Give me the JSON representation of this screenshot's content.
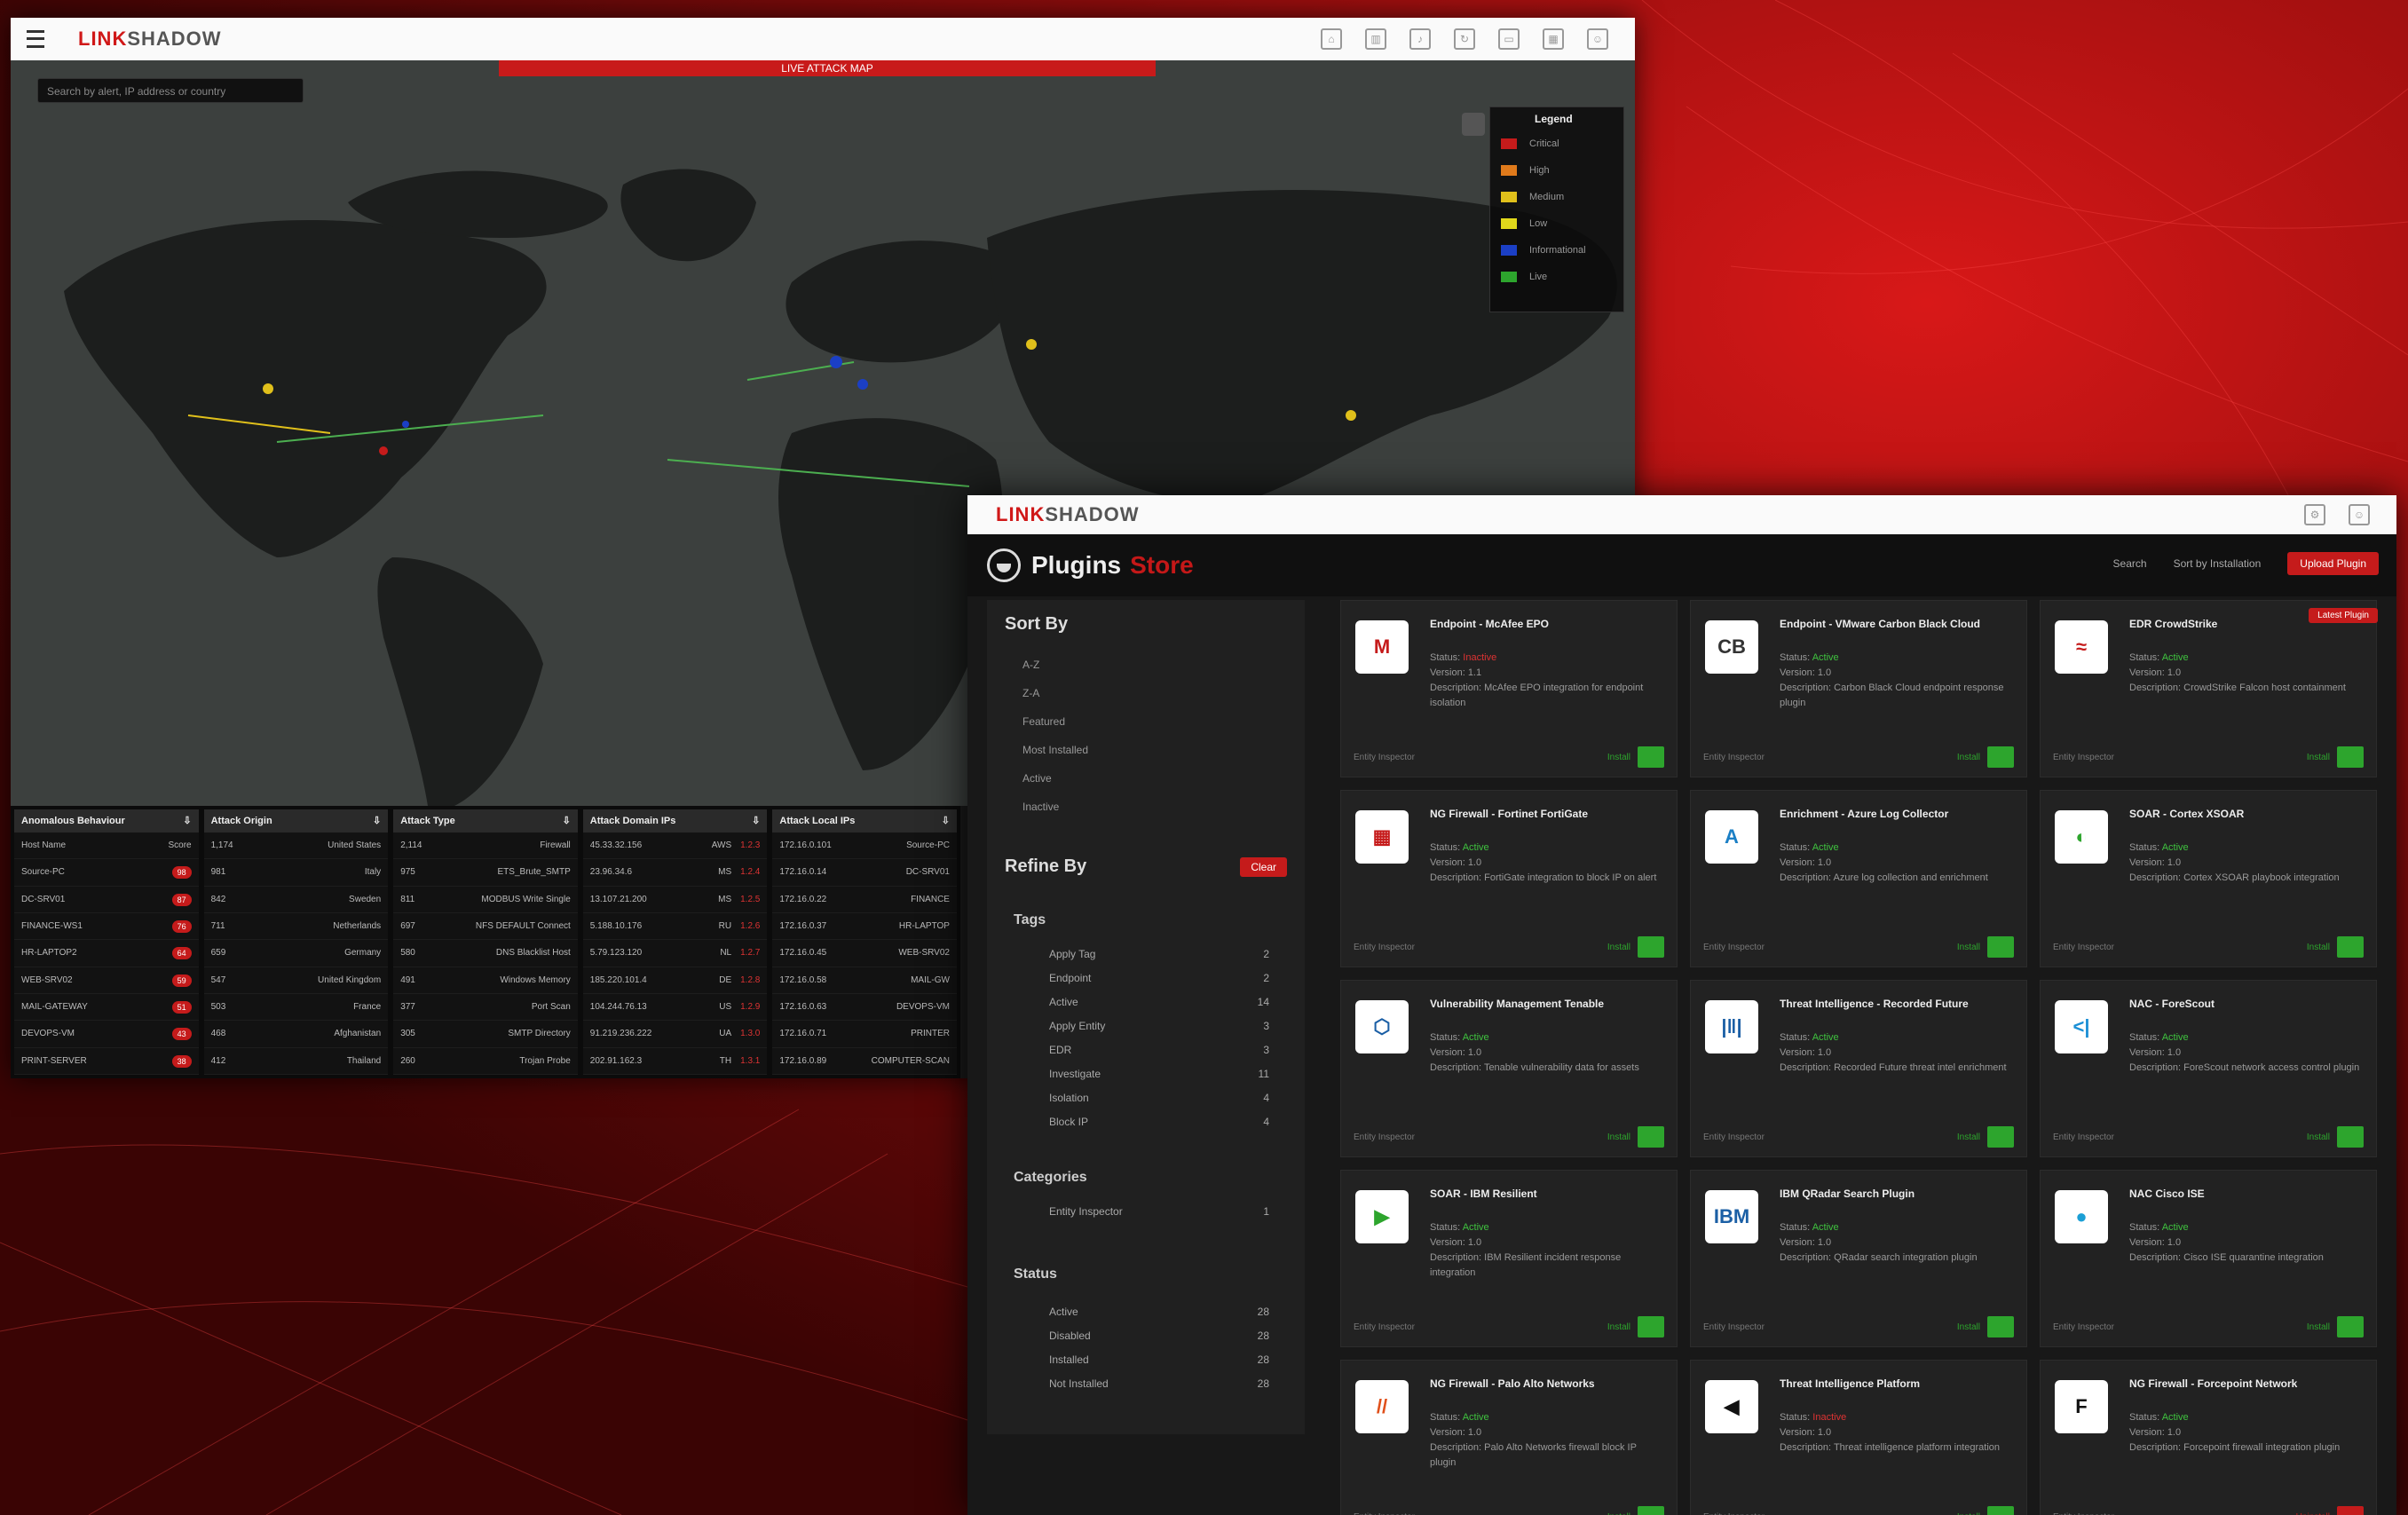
{
  "map_window": {
    "logo_a": "LINK",
    "logo_b": "SHADOW",
    "alert_strip": "LIVE ATTACK MAP",
    "search_placeholder": "Search by alert, IP address or country",
    "legend": {
      "title": "Legend",
      "items": [
        {
          "label": "Critical",
          "color": "#c51b1b"
        },
        {
          "label": "High",
          "color": "#e07a1b"
        },
        {
          "label": "Medium",
          "color": "#e0c01b"
        },
        {
          "label": "Low",
          "color": "#e0d81b"
        },
        {
          "label": "Informational",
          "color": "#1b3fc5"
        },
        {
          "label": "Live",
          "color": "#2da52d"
        }
      ]
    },
    "tables": [
      {
        "title": "Anomalous Behaviour",
        "rows": [
          [
            "Host Name",
            "Score"
          ],
          [
            "Source-PC",
            "98"
          ],
          [
            "DC-SRV01",
            "87"
          ],
          [
            "FINANCE-WS1",
            "76"
          ],
          [
            "HR-LAPTOP2",
            "64"
          ],
          [
            "WEB-SRV02",
            "59"
          ],
          [
            "MAIL-GATEWAY",
            "51"
          ],
          [
            "DEVOPS-VM",
            "43"
          ],
          [
            "PRINT-SERVER",
            "38"
          ]
        ]
      },
      {
        "title": "Attack Origin",
        "rows": [
          [
            "1,174",
            "United States"
          ],
          [
            "981",
            "Italy"
          ],
          [
            "842",
            "Sweden"
          ],
          [
            "711",
            "Netherlands"
          ],
          [
            "659",
            "Germany"
          ],
          [
            "547",
            "United Kingdom"
          ],
          [
            "503",
            "France"
          ],
          [
            "468",
            "Afghanistan"
          ],
          [
            "412",
            "Thailand"
          ]
        ]
      },
      {
        "title": "Attack Type",
        "rows": [
          [
            "2,114",
            "Firewall"
          ],
          [
            "975",
            "ETS_Brute_SMTP"
          ],
          [
            "811",
            "MODBUS Write Single"
          ],
          [
            "697",
            "NFS DEFAULT Connect"
          ],
          [
            "580",
            "DNS Blacklist Host"
          ],
          [
            "491",
            "Windows Memory"
          ],
          [
            "377",
            "Port Scan"
          ],
          [
            "305",
            "SMTP Directory"
          ],
          [
            "260",
            "Trojan Probe"
          ]
        ]
      },
      {
        "title": "Attack Domain IPs",
        "rows": [
          [
            "45.33.32.156",
            "AWS",
            "1.2.3"
          ],
          [
            "23.96.34.6",
            "MS",
            "1.2.4"
          ],
          [
            "13.107.21.200",
            "MS",
            "1.2.5"
          ],
          [
            "5.188.10.176",
            "RU",
            "1.2.6"
          ],
          [
            "5.79.123.120",
            "NL",
            "1.2.7"
          ],
          [
            "185.220.101.4",
            "DE",
            "1.2.8"
          ],
          [
            "104.244.76.13",
            "US",
            "1.2.9"
          ],
          [
            "91.219.236.222",
            "UA",
            "1.3.0"
          ],
          [
            "202.91.162.3",
            "TH",
            "1.3.1"
          ]
        ]
      },
      {
        "title": "Attack Local IPs",
        "rows": [
          [
            "172.16.0.101",
            "Source-PC"
          ],
          [
            "172.16.0.14",
            "DC-SRV01"
          ],
          [
            "172.16.0.22",
            "FINANCE"
          ],
          [
            "172.16.0.37",
            "HR-LAPTOP"
          ],
          [
            "172.16.0.45",
            "WEB-SRV02"
          ],
          [
            "172.16.0.58",
            "MAIL-GW"
          ],
          [
            "172.16.0.63",
            "DEVOPS-VM"
          ],
          [
            "172.16.0.71",
            "PRINTER"
          ],
          [
            "172.16.0.89",
            "COMPUTER-SCAN"
          ]
        ]
      }
    ]
  },
  "plugins_window": {
    "logo_a": "LINK",
    "logo_b": "SHADOW",
    "title": "Plugins",
    "title_accent": "Store",
    "header_links": [
      "Search",
      "Sort by Installation"
    ],
    "upload_button": "Upload Plugin",
    "sidebar": {
      "sort_title": "Sort By",
      "sort_items": [
        "A-Z",
        "Z-A",
        "Featured",
        "Most Installed",
        "Active",
        "Inactive"
      ],
      "refine_title": "Refine By",
      "clear_button": "Clear",
      "tags_title": "Tags",
      "tags": [
        {
          "label": "Apply Tag",
          "count": "2"
        },
        {
          "label": "Endpoint",
          "count": "2"
        },
        {
          "label": "Active",
          "count": "14"
        },
        {
          "label": "Apply Entity",
          "count": "3"
        },
        {
          "label": "EDR",
          "count": "3"
        },
        {
          "label": "Investigate",
          "count": "11"
        },
        {
          "label": "Isolation",
          "count": "4"
        },
        {
          "label": "Block IP",
          "count": "4"
        }
      ],
      "categories_title": "Categories",
      "categories": [
        {
          "label": "Entity Inspector",
          "count": "1"
        }
      ],
      "status_title": "Status",
      "statuses": [
        {
          "label": "Active",
          "count": "28"
        },
        {
          "label": "Disabled",
          "count": "28"
        },
        {
          "label": "Installed",
          "count": "28"
        },
        {
          "label": "Not Installed",
          "count": "28"
        }
      ]
    },
    "cards": [
      {
        "name": "Endpoint - McAfee EPO",
        "status": "Inactive",
        "status_ok": false,
        "version": "1.1",
        "desc": "McAfee EPO integration for endpoint isolation",
        "icon": "M",
        "icon_color": "#c51b1b",
        "footer": "Entity Inspector",
        "action": "Install"
      },
      {
        "name": "Endpoint - VMware Carbon Black Cloud",
        "status": "Active",
        "status_ok": true,
        "version": "1.0",
        "desc": "Carbon Black Cloud endpoint response plugin",
        "icon": "CB",
        "icon_color": "#333",
        "footer": "Entity Inspector",
        "action": "Install"
      },
      {
        "name": "EDR CrowdStrike",
        "status": "Active",
        "status_ok": true,
        "version": "1.0",
        "desc": "CrowdStrike Falcon host containment",
        "icon": "≈",
        "icon_color": "#c51b1b",
        "footer": "Entity Inspector",
        "action": "Install",
        "tag": "Latest Plugin"
      },
      {
        "name": "NG Firewall - Fortinet FortiGate",
        "status": "Active",
        "status_ok": true,
        "version": "1.0",
        "desc": "FortiGate integration to block IP on alert",
        "icon": "▦",
        "icon_color": "#c51b1b",
        "footer": "Entity Inspector",
        "action": "Install"
      },
      {
        "name": "Enrichment - Azure Log Collector",
        "status": "Active",
        "status_ok": true,
        "version": "1.0",
        "desc": "Azure log collection and enrichment",
        "icon": "A",
        "icon_color": "#1b7fc5",
        "footer": "Entity Inspector",
        "action": "Install"
      },
      {
        "name": "SOAR - Cortex XSOAR",
        "status": "Active",
        "status_ok": true,
        "version": "1.0",
        "desc": "Cortex XSOAR playbook integration",
        "icon": "◐",
        "icon_color": "#2da52d",
        "footer": "Entity Inspector",
        "action": "Install"
      },
      {
        "name": "Vulnerability Management Tenable",
        "status": "Active",
        "status_ok": true,
        "version": "1.0",
        "desc": "Tenable vulnerability data for assets",
        "icon": "⬡",
        "icon_color": "#1b5fa5",
        "footer": "Entity Inspector",
        "action": "Install"
      },
      {
        "name": "Threat Intelligence - Recorded Future",
        "status": "Active",
        "status_ok": true,
        "version": "1.0",
        "desc": "Recorded Future threat intel enrichment",
        "icon": "|‖|",
        "icon_color": "#1b5fa5",
        "footer": "Entity Inspector",
        "action": "Install"
      },
      {
        "name": "NAC - ForeScout",
        "status": "Active",
        "status_ok": true,
        "version": "1.0",
        "desc": "ForeScout network access control plugin",
        "icon": "<|",
        "icon_color": "#1b8fd5",
        "footer": "Entity Inspector",
        "action": "Install"
      },
      {
        "name": "SOAR - IBM Resilient",
        "status": "Active",
        "status_ok": true,
        "version": "1.0",
        "desc": "IBM Resilient incident response integration",
        "icon": "▶",
        "icon_color": "#2da52d",
        "footer": "Entity Inspector",
        "action": "Install"
      },
      {
        "name": "IBM QRadar Search Plugin",
        "status": "Active",
        "status_ok": true,
        "version": "1.0",
        "desc": "QRadar search integration plugin",
        "icon": "IBM",
        "icon_color": "#1b5fa5",
        "footer": "Entity Inspector",
        "action": "Install"
      },
      {
        "name": "NAC Cisco ISE",
        "status": "Active",
        "status_ok": true,
        "version": "1.0",
        "desc": "Cisco ISE quarantine integration",
        "icon": "●",
        "icon_color": "#1b9fd5",
        "footer": "Entity Inspector",
        "action": "Install"
      },
      {
        "name": "NG Firewall - Palo Alto Networks",
        "status": "Active",
        "status_ok": true,
        "version": "1.0",
        "desc": "Palo Alto Networks firewall block IP plugin",
        "icon": "//",
        "icon_color": "#e0501b",
        "footer": "Entity Inspector",
        "action": "Install"
      },
      {
        "name": "Threat Intelligence Platform",
        "status": "Inactive",
        "status_ok": false,
        "version": "1.0",
        "desc": "Threat intelligence platform integration",
        "icon": "◀",
        "icon_color": "#111",
        "footer": "Entity Inspector",
        "action": "Install"
      },
      {
        "name": "NG Firewall - Forcepoint Network",
        "status": "Active",
        "status_ok": true,
        "version": "1.0",
        "desc": "Forcepoint firewall integration plugin",
        "icon": "F",
        "icon_color": "#111",
        "footer": "Entity Inspector",
        "action": "Uninstall",
        "action_red": true
      }
    ]
  }
}
